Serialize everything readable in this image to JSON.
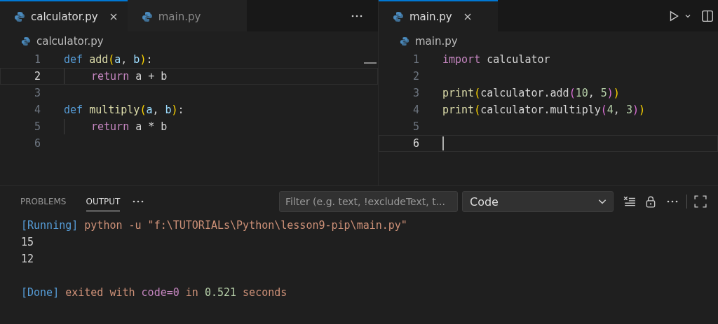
{
  "editor_groups": [
    {
      "tabs": [
        {
          "label": "calculator.py",
          "selected": true
        },
        {
          "label": "main.py",
          "selected": false
        }
      ],
      "breadcrumb": "calculator.py",
      "lines": [
        {
          "number": "1",
          "current": false,
          "indented": false,
          "tokens": [
            {
              "t": "def ",
              "color": "#569cd6"
            },
            {
              "t": "add",
              "color": "#dcdcaa"
            },
            {
              "t": "(",
              "color": "#ffd700"
            },
            {
              "t": "a",
              "color": "#9cdcfe"
            },
            {
              "t": ", ",
              "color": "#d4d4d4"
            },
            {
              "t": "b",
              "color": "#9cdcfe"
            },
            {
              "t": ")",
              "color": "#ffd700"
            },
            {
              "t": ":",
              "color": "#d4d4d4"
            }
          ]
        },
        {
          "number": "2",
          "current": true,
          "indented": true,
          "tokens": [
            {
              "t": "return",
              "color": "#c586c0"
            },
            {
              "t": " a + b",
              "color": "#d4d4d4"
            }
          ]
        },
        {
          "number": "3",
          "current": false,
          "indented": false
        },
        {
          "number": "4",
          "current": false,
          "indented": false,
          "tokens": [
            {
              "t": "def ",
              "color": "#569cd6"
            },
            {
              "t": "multiply",
              "color": "#dcdcaa"
            },
            {
              "t": "(",
              "color": "#ffd700"
            },
            {
              "t": "a",
              "color": "#9cdcfe"
            },
            {
              "t": ", ",
              "color": "#d4d4d4"
            },
            {
              "t": "b",
              "color": "#9cdcfe"
            },
            {
              "t": ")",
              "color": "#ffd700"
            },
            {
              "t": ":",
              "color": "#d4d4d4"
            }
          ]
        },
        {
          "number": "5",
          "current": false,
          "indented": true,
          "tokens": [
            {
              "t": "return",
              "color": "#c586c0"
            },
            {
              "t": " a * b",
              "color": "#d4d4d4"
            }
          ]
        },
        {
          "number": "6",
          "current": false,
          "indented": false
        }
      ]
    },
    {
      "tabs": [
        {
          "label": "main.py",
          "selected": true
        }
      ],
      "breadcrumb": "main.py",
      "lines": [
        {
          "number": "1",
          "current": false,
          "indented": false,
          "tokens": [
            {
              "t": "import",
              "color": "#c586c0"
            },
            {
              "t": " calculator",
              "color": "#d4d4d4"
            }
          ]
        },
        {
          "number": "2",
          "current": false,
          "indented": false
        },
        {
          "number": "3",
          "current": false,
          "indented": false,
          "tokens": [
            {
              "t": "print",
              "color": "#dcdcaa"
            },
            {
              "t": "(",
              "color": "#ffd700"
            },
            {
              "t": "calculator.add",
              "color": "#d4d4d4"
            },
            {
              "t": "(",
              "color": "#da70d6"
            },
            {
              "t": "10",
              "color": "#b5cea8"
            },
            {
              "t": ", ",
              "color": "#d4d4d4"
            },
            {
              "t": "5",
              "color": "#b5cea8"
            },
            {
              "t": ")",
              "color": "#da70d6"
            },
            {
              "t": ")",
              "color": "#ffd700"
            }
          ]
        },
        {
          "number": "4",
          "current": false,
          "indented": false,
          "tokens": [
            {
              "t": "print",
              "color": "#dcdcaa"
            },
            {
              "t": "(",
              "color": "#ffd700"
            },
            {
              "t": "calculator.multiply",
              "color": "#d4d4d4"
            },
            {
              "t": "(",
              "color": "#da70d6"
            },
            {
              "t": "4",
              "color": "#b5cea8"
            },
            {
              "t": ", ",
              "color": "#d4d4d4"
            },
            {
              "t": "3",
              "color": "#b5cea8"
            },
            {
              "t": ")",
              "color": "#da70d6"
            },
            {
              "t": ")",
              "color": "#ffd700"
            }
          ]
        },
        {
          "number": "5",
          "current": false,
          "indented": false
        },
        {
          "number": "6",
          "current": true,
          "indented": false
        }
      ]
    }
  ],
  "panel": {
    "tabs": [
      {
        "label": "PROBLEMS",
        "selected": false
      },
      {
        "label": "OUTPUT",
        "selected": true
      }
    ],
    "filter": {
      "placeholder": "Filter (e.g. text, !excludeText, t..."
    },
    "channel": "Code",
    "output": [
      {
        "kind": "text",
        "tokens": [
          {
            "t": "[Running]",
            "color": "#569cd6"
          },
          {
            "t": " python -u \"f:\\TUTORIALs\\Python\\lesson9-pip\\main.py\"",
            "color": "#ce9178"
          }
        ]
      },
      {
        "kind": "text",
        "tokens": [
          {
            "t": "15",
            "color": "#d4d4d4"
          }
        ]
      },
      {
        "kind": "text",
        "tokens": [
          {
            "t": "12",
            "color": "#d4d4d4"
          }
        ]
      },
      {
        "kind": "blank"
      },
      {
        "kind": "text",
        "tokens": [
          {
            "t": "[Done]",
            "color": "#569cd6"
          },
          {
            "t": " exited with ",
            "color": "#ce9178"
          },
          {
            "t": "code=0",
            "color": "#c586c0"
          },
          {
            "t": " in ",
            "color": "#ce9178"
          },
          {
            "t": "0.521",
            "color": "#b5cea8"
          },
          {
            "t": " seconds",
            "color": "#ce9178"
          }
        ]
      }
    ]
  }
}
